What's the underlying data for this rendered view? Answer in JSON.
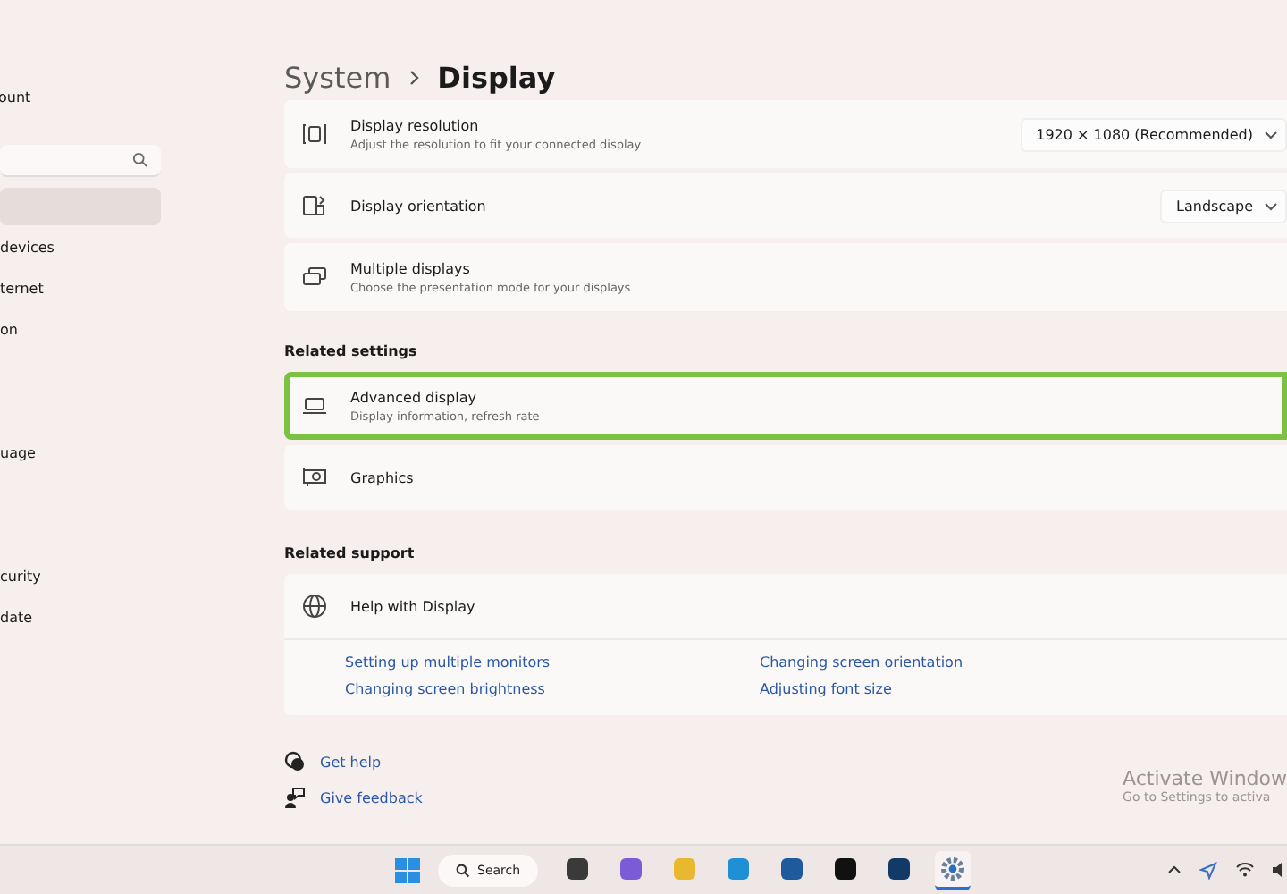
{
  "sidebar": {
    "account_text": "ount",
    "items": [
      {
        "selected": true
      },
      {
        "label": "devices",
        "selected": false
      },
      {
        "label": "ternet",
        "selected": false
      },
      {
        "label": "on",
        "selected": false
      },
      {
        "label": "uage",
        "selected": false
      },
      {
        "label": "curity",
        "selected": false
      },
      {
        "label": "date",
        "selected": false
      }
    ]
  },
  "breadcrumb": [
    "System",
    "Display"
  ],
  "display_settings": [
    {
      "kind": "dropdown",
      "title": "Display resolution",
      "subtitle": "Adjust the resolution to fit your connected display",
      "value": "1920 × 1080 (Recommended)"
    },
    {
      "kind": "dropdown",
      "title": "Display orientation",
      "value": "Landscape"
    },
    {
      "kind": "link",
      "title": "Multiple displays",
      "subtitle": "Choose the presentation mode for your displays"
    }
  ],
  "related_settings": {
    "heading": "Related settings",
    "items": [
      {
        "title": "Advanced display",
        "subtitle": "Display information, refresh rate",
        "highlighted": true
      },
      {
        "title": "Graphics",
        "highlighted": false
      }
    ]
  },
  "related_support": {
    "heading": "Related support",
    "title": "Help with Display",
    "expanded": true,
    "links": [
      "Setting up multiple monitors",
      "Changing screen orientation",
      "Changing screen brightness",
      "Adjusting font size"
    ]
  },
  "footer_links": [
    "Get help",
    "Give feedback"
  ],
  "activation_notice": {
    "title": "Activate Window",
    "text": "Go to Settings to activa"
  },
  "taskbar": {
    "search_label": "Search",
    "apps": [
      {
        "selected": false
      },
      {
        "selected": false
      },
      {
        "selected": false
      },
      {
        "selected": false
      },
      {
        "selected": false
      },
      {
        "selected": false
      },
      {
        "selected": false
      },
      {
        "selected": true
      }
    ]
  }
}
